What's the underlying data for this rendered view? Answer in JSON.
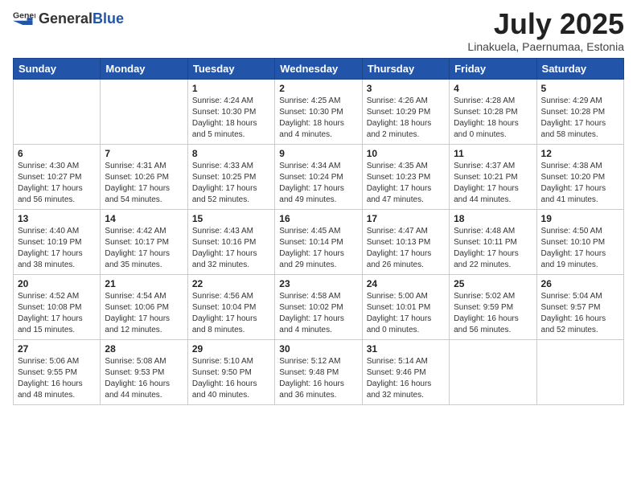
{
  "header": {
    "logo_general": "General",
    "logo_blue": "Blue",
    "month": "July 2025",
    "location": "Linakuela, Paernumaa, Estonia"
  },
  "days_of_week": [
    "Sunday",
    "Monday",
    "Tuesday",
    "Wednesday",
    "Thursday",
    "Friday",
    "Saturday"
  ],
  "weeks": [
    [
      {
        "day": "",
        "info": ""
      },
      {
        "day": "",
        "info": ""
      },
      {
        "day": "1",
        "info": "Sunrise: 4:24 AM\nSunset: 10:30 PM\nDaylight: 18 hours\nand 5 minutes."
      },
      {
        "day": "2",
        "info": "Sunrise: 4:25 AM\nSunset: 10:30 PM\nDaylight: 18 hours\nand 4 minutes."
      },
      {
        "day": "3",
        "info": "Sunrise: 4:26 AM\nSunset: 10:29 PM\nDaylight: 18 hours\nand 2 minutes."
      },
      {
        "day": "4",
        "info": "Sunrise: 4:28 AM\nSunset: 10:28 PM\nDaylight: 18 hours\nand 0 minutes."
      },
      {
        "day": "5",
        "info": "Sunrise: 4:29 AM\nSunset: 10:28 PM\nDaylight: 17 hours\nand 58 minutes."
      }
    ],
    [
      {
        "day": "6",
        "info": "Sunrise: 4:30 AM\nSunset: 10:27 PM\nDaylight: 17 hours\nand 56 minutes."
      },
      {
        "day": "7",
        "info": "Sunrise: 4:31 AM\nSunset: 10:26 PM\nDaylight: 17 hours\nand 54 minutes."
      },
      {
        "day": "8",
        "info": "Sunrise: 4:33 AM\nSunset: 10:25 PM\nDaylight: 17 hours\nand 52 minutes."
      },
      {
        "day": "9",
        "info": "Sunrise: 4:34 AM\nSunset: 10:24 PM\nDaylight: 17 hours\nand 49 minutes."
      },
      {
        "day": "10",
        "info": "Sunrise: 4:35 AM\nSunset: 10:23 PM\nDaylight: 17 hours\nand 47 minutes."
      },
      {
        "day": "11",
        "info": "Sunrise: 4:37 AM\nSunset: 10:21 PM\nDaylight: 17 hours\nand 44 minutes."
      },
      {
        "day": "12",
        "info": "Sunrise: 4:38 AM\nSunset: 10:20 PM\nDaylight: 17 hours\nand 41 minutes."
      }
    ],
    [
      {
        "day": "13",
        "info": "Sunrise: 4:40 AM\nSunset: 10:19 PM\nDaylight: 17 hours\nand 38 minutes."
      },
      {
        "day": "14",
        "info": "Sunrise: 4:42 AM\nSunset: 10:17 PM\nDaylight: 17 hours\nand 35 minutes."
      },
      {
        "day": "15",
        "info": "Sunrise: 4:43 AM\nSunset: 10:16 PM\nDaylight: 17 hours\nand 32 minutes."
      },
      {
        "day": "16",
        "info": "Sunrise: 4:45 AM\nSunset: 10:14 PM\nDaylight: 17 hours\nand 29 minutes."
      },
      {
        "day": "17",
        "info": "Sunrise: 4:47 AM\nSunset: 10:13 PM\nDaylight: 17 hours\nand 26 minutes."
      },
      {
        "day": "18",
        "info": "Sunrise: 4:48 AM\nSunset: 10:11 PM\nDaylight: 17 hours\nand 22 minutes."
      },
      {
        "day": "19",
        "info": "Sunrise: 4:50 AM\nSunset: 10:10 PM\nDaylight: 17 hours\nand 19 minutes."
      }
    ],
    [
      {
        "day": "20",
        "info": "Sunrise: 4:52 AM\nSunset: 10:08 PM\nDaylight: 17 hours\nand 15 minutes."
      },
      {
        "day": "21",
        "info": "Sunrise: 4:54 AM\nSunset: 10:06 PM\nDaylight: 17 hours\nand 12 minutes."
      },
      {
        "day": "22",
        "info": "Sunrise: 4:56 AM\nSunset: 10:04 PM\nDaylight: 17 hours\nand 8 minutes."
      },
      {
        "day": "23",
        "info": "Sunrise: 4:58 AM\nSunset: 10:02 PM\nDaylight: 17 hours\nand 4 minutes."
      },
      {
        "day": "24",
        "info": "Sunrise: 5:00 AM\nSunset: 10:01 PM\nDaylight: 17 hours\nand 0 minutes."
      },
      {
        "day": "25",
        "info": "Sunrise: 5:02 AM\nSunset: 9:59 PM\nDaylight: 16 hours\nand 56 minutes."
      },
      {
        "day": "26",
        "info": "Sunrise: 5:04 AM\nSunset: 9:57 PM\nDaylight: 16 hours\nand 52 minutes."
      }
    ],
    [
      {
        "day": "27",
        "info": "Sunrise: 5:06 AM\nSunset: 9:55 PM\nDaylight: 16 hours\nand 48 minutes."
      },
      {
        "day": "28",
        "info": "Sunrise: 5:08 AM\nSunset: 9:53 PM\nDaylight: 16 hours\nand 44 minutes."
      },
      {
        "day": "29",
        "info": "Sunrise: 5:10 AM\nSunset: 9:50 PM\nDaylight: 16 hours\nand 40 minutes."
      },
      {
        "day": "30",
        "info": "Sunrise: 5:12 AM\nSunset: 9:48 PM\nDaylight: 16 hours\nand 36 minutes."
      },
      {
        "day": "31",
        "info": "Sunrise: 5:14 AM\nSunset: 9:46 PM\nDaylight: 16 hours\nand 32 minutes."
      },
      {
        "day": "",
        "info": ""
      },
      {
        "day": "",
        "info": ""
      }
    ]
  ]
}
